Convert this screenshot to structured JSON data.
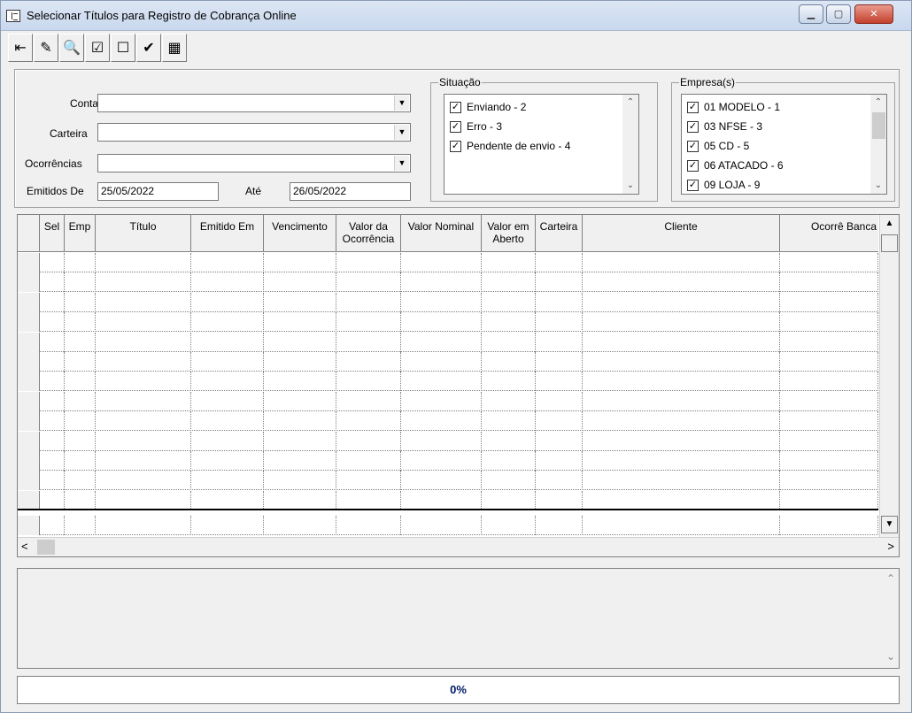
{
  "window": {
    "title": "Selecionar Títulos para Registro de Cobrança Online",
    "minimize_glyph": "▁",
    "maximize_glyph": "▢",
    "close_glyph": "✕"
  },
  "toolbar": {
    "buttons": [
      {
        "name": "exit-door-icon",
        "glyph": "⇤"
      },
      {
        "name": "eraser-icon",
        "glyph": "✎"
      },
      {
        "name": "binoculars-icon",
        "glyph": "🔍"
      },
      {
        "name": "select-all-icon",
        "glyph": "☑"
      },
      {
        "name": "unselect-all-icon",
        "glyph": "☐"
      },
      {
        "name": "confirm-check-icon",
        "glyph": "✔"
      },
      {
        "name": "adjust-columns-icon",
        "glyph": "▦"
      }
    ]
  },
  "filters": {
    "conta_label": "Conta",
    "carteira_label": "Carteira",
    "ocorrencias_label": "Ocorrências",
    "emitidos_de_label": "Emitidos De",
    "emitidos_de_value": "25/05/2022",
    "ate_label": "Até",
    "ate_value": "26/05/2022",
    "conta_value": "",
    "carteira_value": "",
    "ocorrencias_value": "",
    "dropdown_glyph": "▼"
  },
  "situacao": {
    "title": "Situação",
    "items": [
      {
        "label": "Enviando - 2",
        "checked": true
      },
      {
        "label": "Erro - 3",
        "checked": true
      },
      {
        "label": "Pendente de envio - 4",
        "checked": true
      }
    ]
  },
  "empresas": {
    "title": "Empresa(s)",
    "items": [
      {
        "label": "01 MODELO - 1",
        "checked": true
      },
      {
        "label": "03 NFSE - 3",
        "checked": true
      },
      {
        "label": "05 CD - 5",
        "checked": true
      },
      {
        "label": "06 ATACADO - 6",
        "checked": true
      },
      {
        "label": "09 LOJA - 9",
        "checked": true
      }
    ]
  },
  "check_glyph": "✓",
  "scroll": {
    "up": "▲",
    "down": "▼",
    "left": "<",
    "right": ">",
    "up_thin": "⌃",
    "down_thin": "⌄"
  },
  "grid": {
    "columns": [
      {
        "key": "sel",
        "label": "Sel"
      },
      {
        "key": "emp",
        "label": "Emp"
      },
      {
        "key": "titulo",
        "label": "Título"
      },
      {
        "key": "emitido_em",
        "label": "Emitido Em"
      },
      {
        "key": "vencimento",
        "label": "Vencimento"
      },
      {
        "key": "valor_ocorrencia",
        "label": "Valor da Ocorrência"
      },
      {
        "key": "valor_nominal",
        "label": "Valor Nominal"
      },
      {
        "key": "valor_aberto",
        "label": "Valor em Aberto"
      },
      {
        "key": "carteira",
        "label": "Carteira"
      },
      {
        "key": "cliente",
        "label": "Cliente"
      },
      {
        "key": "ocorrencia_bancaria",
        "label": "Ocorrê Banca"
      }
    ],
    "rows": []
  },
  "progress": {
    "label": "0%"
  }
}
